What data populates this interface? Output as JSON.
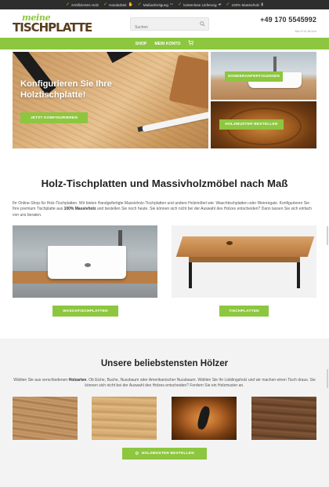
{
  "topbar": {
    "items": [
      {
        "label": "zertifiziertes Holz",
        "icon": "check-icon"
      },
      {
        "label": "Handarbeit",
        "icon": "check-icon"
      },
      {
        "label": "Maßanfertigung",
        "icon": "check-icon"
      },
      {
        "label": "kostenlose Lieferung",
        "icon": "check-icon"
      },
      {
        "label": "100% Massivholz",
        "icon": "check-icon"
      }
    ]
  },
  "header": {
    "logo_line1": "meine",
    "logo_line2": "TISCHPLATTE",
    "search_placeholder": "Suchen",
    "phone": "+49 170 5545992",
    "phone_sub": "Mo-Fr 8-18 Uhr"
  },
  "nav": {
    "items": [
      "SHOP",
      "MEIN KONTO"
    ],
    "cart_icon": "cart-icon"
  },
  "hero": {
    "title": "Konfigurieren Sie Ihre Holztischplatte!",
    "config_button": "JETZT KONFIGURIEREN",
    "sonder_button": "SONDERANFERTIGUNGEN",
    "holzmuster_button": "HOLZMUSTER BESTELLEN"
  },
  "intro": {
    "title": "Holz-Tischplatten und Massivholzmöbel nach Maß",
    "text_before": "Ihr Online-Shop für Holz-Tischplatten. Wir bieten Handgefertigte Massivholz-Tischplatten und andere Holzmöbel wie: Waschtischplatten oder Weinregale. Konfigurieren Sie Ihre premium Tischplatte aus ",
    "text_bold": "100% Massivholz",
    "text_after": " und bestellen Sie noch heute. Sie können sich nicht bei der Auswahl des Holzes entscheiden? Dann lassen Sie sich einfach von uns beraten.",
    "product1_button": "WASCHTISCHPLATTEN",
    "product2_button": "TISCHPLATTEN"
  },
  "woods": {
    "title": "Unsere beliebstensten Hölzer",
    "text_before": "Wählen Sie aus verschiedenen ",
    "text_bold": "Holzarten",
    "text_after": ". Ob Eiche, Buche, Nussbaum oder Amerikanischer Nussbaum. Wählen Sie Ihr Lieblingsholz und wir machen einen Tisch draus. Sie können sich nicht bei der Auswahl des Holzes entscheiden? Fordern Sie ein Holzmuster an.",
    "button": "HOLZMUSTER BESTELLEN"
  },
  "colors": {
    "accent_green": "#8dc63f",
    "topbar": "#2d2d2d",
    "logo_brown": "#5a3d1e"
  }
}
